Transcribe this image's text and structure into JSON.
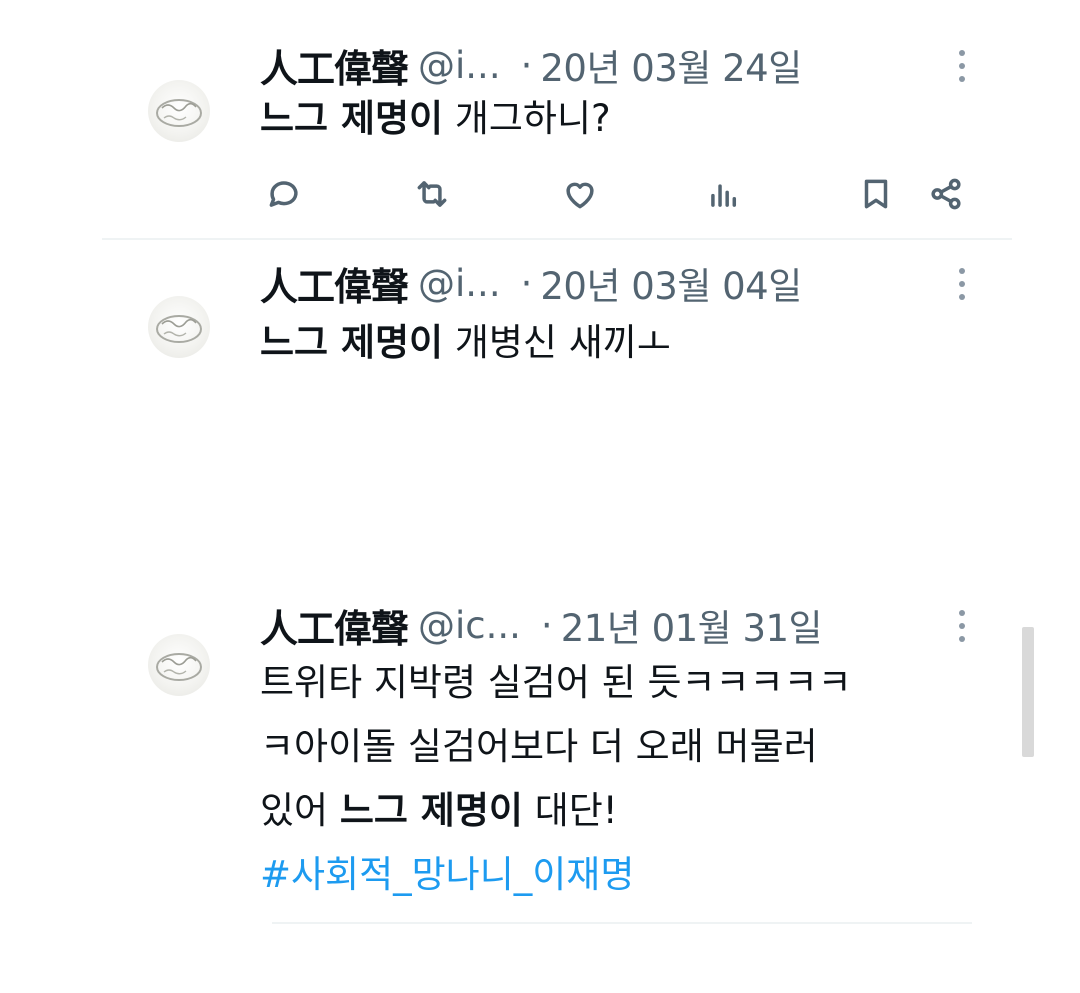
{
  "tweets": [
    {
      "name": "人工偉聲",
      "handle": "@i...",
      "separator": "·",
      "date": "20년 03월 24일",
      "text_bold": "느그 제명이",
      "text_rest": " 개그하니?"
    },
    {
      "name": "人工偉聲",
      "handle": "@i...",
      "separator": "·",
      "date": "20년 03월 04일",
      "text_bold": "느그 제명이",
      "text_rest": " 개병신 새끼ㅗ"
    },
    {
      "name": "人工偉聲",
      "handle": "@ic...",
      "separator": "·",
      "date": "21년 01월 31일",
      "line1": "트위타 지박령 실검어 된 듯ㅋㅋㅋㅋㅋ",
      "line2": "ㅋ아이돌 실검어보다 더 오래 머물러",
      "line3_pre": "있어 ",
      "line3_bold": "느그 제명이",
      "line3_post": " 대단!",
      "hashtag": "#사회적_망나니_이재명"
    }
  ],
  "icons": {
    "reply": "speech-bubble-icon",
    "retweet": "retweet-icon",
    "like": "heart-icon",
    "views": "bar-chart-icon",
    "bookmark": "bookmark-icon",
    "share": "share-icon",
    "more": "three-dot-vertical-icon"
  },
  "colors": {
    "text": "#0f1419",
    "muted": "#536471",
    "link": "#1d9bf0"
  }
}
